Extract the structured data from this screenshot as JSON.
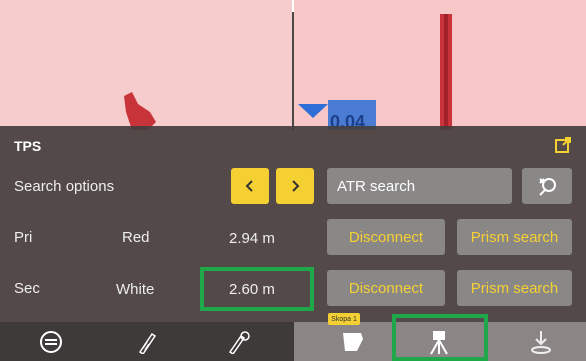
{
  "panel": {
    "title": "TPS",
    "search_options_label": "Search options",
    "atr_search_value": "ATR search",
    "rows": [
      {
        "label": "Pri",
        "color": "Red",
        "distance": "2.94 m",
        "disconnect": "Disconnect",
        "prism_search": "Prism search"
      },
      {
        "label": "Sec",
        "color": "White",
        "distance": "2.60 m",
        "disconnect": "Disconnect",
        "prism_search": "Prism search"
      }
    ]
  },
  "toolbar": {
    "tag_label": "Skopa 1"
  },
  "overlay_value": "0.04",
  "colors": {
    "accent": "#f5d033",
    "highlight": "#1fa84a",
    "panel_bg": "#443e3e",
    "machine_red": "#c8343a"
  }
}
